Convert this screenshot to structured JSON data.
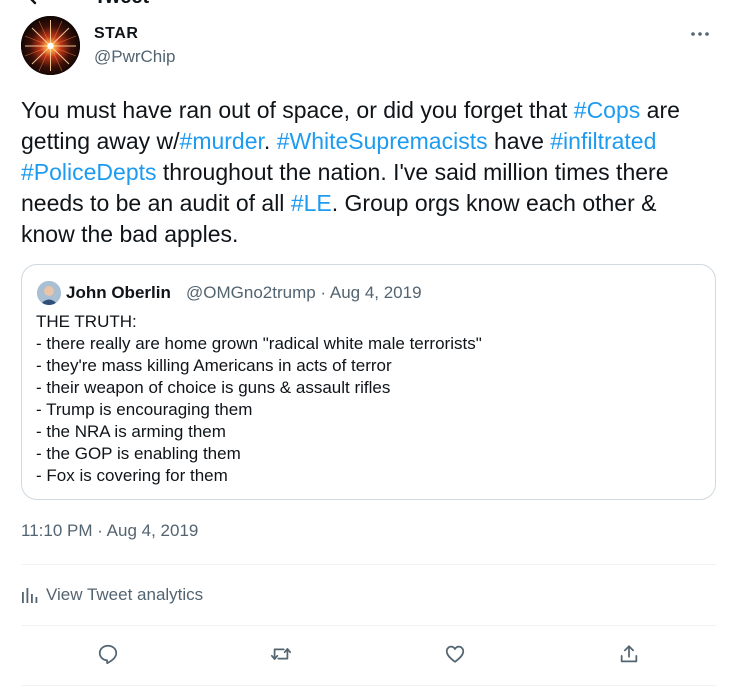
{
  "header": {
    "title": "Tweet",
    "back_icon": "back-arrow-icon"
  },
  "tweet": {
    "author": {
      "name": "STAR",
      "handle": "@PwrChip"
    },
    "segments": [
      {
        "text": "You must have ran out of space, or did you forget that ",
        "hashtag": false
      },
      {
        "text": "#Cops",
        "hashtag": true
      },
      {
        "text": " are getting away w/",
        "hashtag": false
      },
      {
        "text": "#murder",
        "hashtag": true
      },
      {
        "text": ". ",
        "hashtag": false
      },
      {
        "text": "#WhiteSupremacists",
        "hashtag": true
      },
      {
        "text": " have ",
        "hashtag": false
      },
      {
        "text": "#infiltrated",
        "hashtag": true
      },
      {
        "text": " ",
        "hashtag": false
      },
      {
        "text": "#PoliceDepts",
        "hashtag": true
      },
      {
        "text": " throughout the nation. I've said million times there needs to be an audit of all ",
        "hashtag": false
      },
      {
        "text": "#LE",
        "hashtag": true
      },
      {
        "text": ". Group orgs know each other & know the bad apples.",
        "hashtag": false
      }
    ],
    "timestamp": "11:10 PM · Aug 4, 2019"
  },
  "quote": {
    "name": "John Oberlin",
    "meta": "@OMGno2trump · Aug 4, 2019",
    "lines": [
      "THE TRUTH:",
      "- there really are home grown \"radical white male terrorists\"",
      "- they're mass killing Americans in acts of terror",
      "- their weapon of choice is guns & assault rifles",
      "- Trump is encouraging them",
      "- the NRA is arming them",
      "- the GOP is enabling them",
      "- Fox is covering for them"
    ]
  },
  "analytics": {
    "label": "View Tweet analytics"
  },
  "actions": [
    {
      "name": "reply-button",
      "icon": "reply-icon"
    },
    {
      "name": "retweet-button",
      "icon": "retweet-icon"
    },
    {
      "name": "like-button",
      "icon": "heart-icon"
    },
    {
      "name": "share-button",
      "icon": "share-icon"
    }
  ],
  "colors": {
    "link": "#1d9bf0",
    "secondary_text": "#536471",
    "border": "#cfd9de",
    "text": "#0f1419"
  }
}
